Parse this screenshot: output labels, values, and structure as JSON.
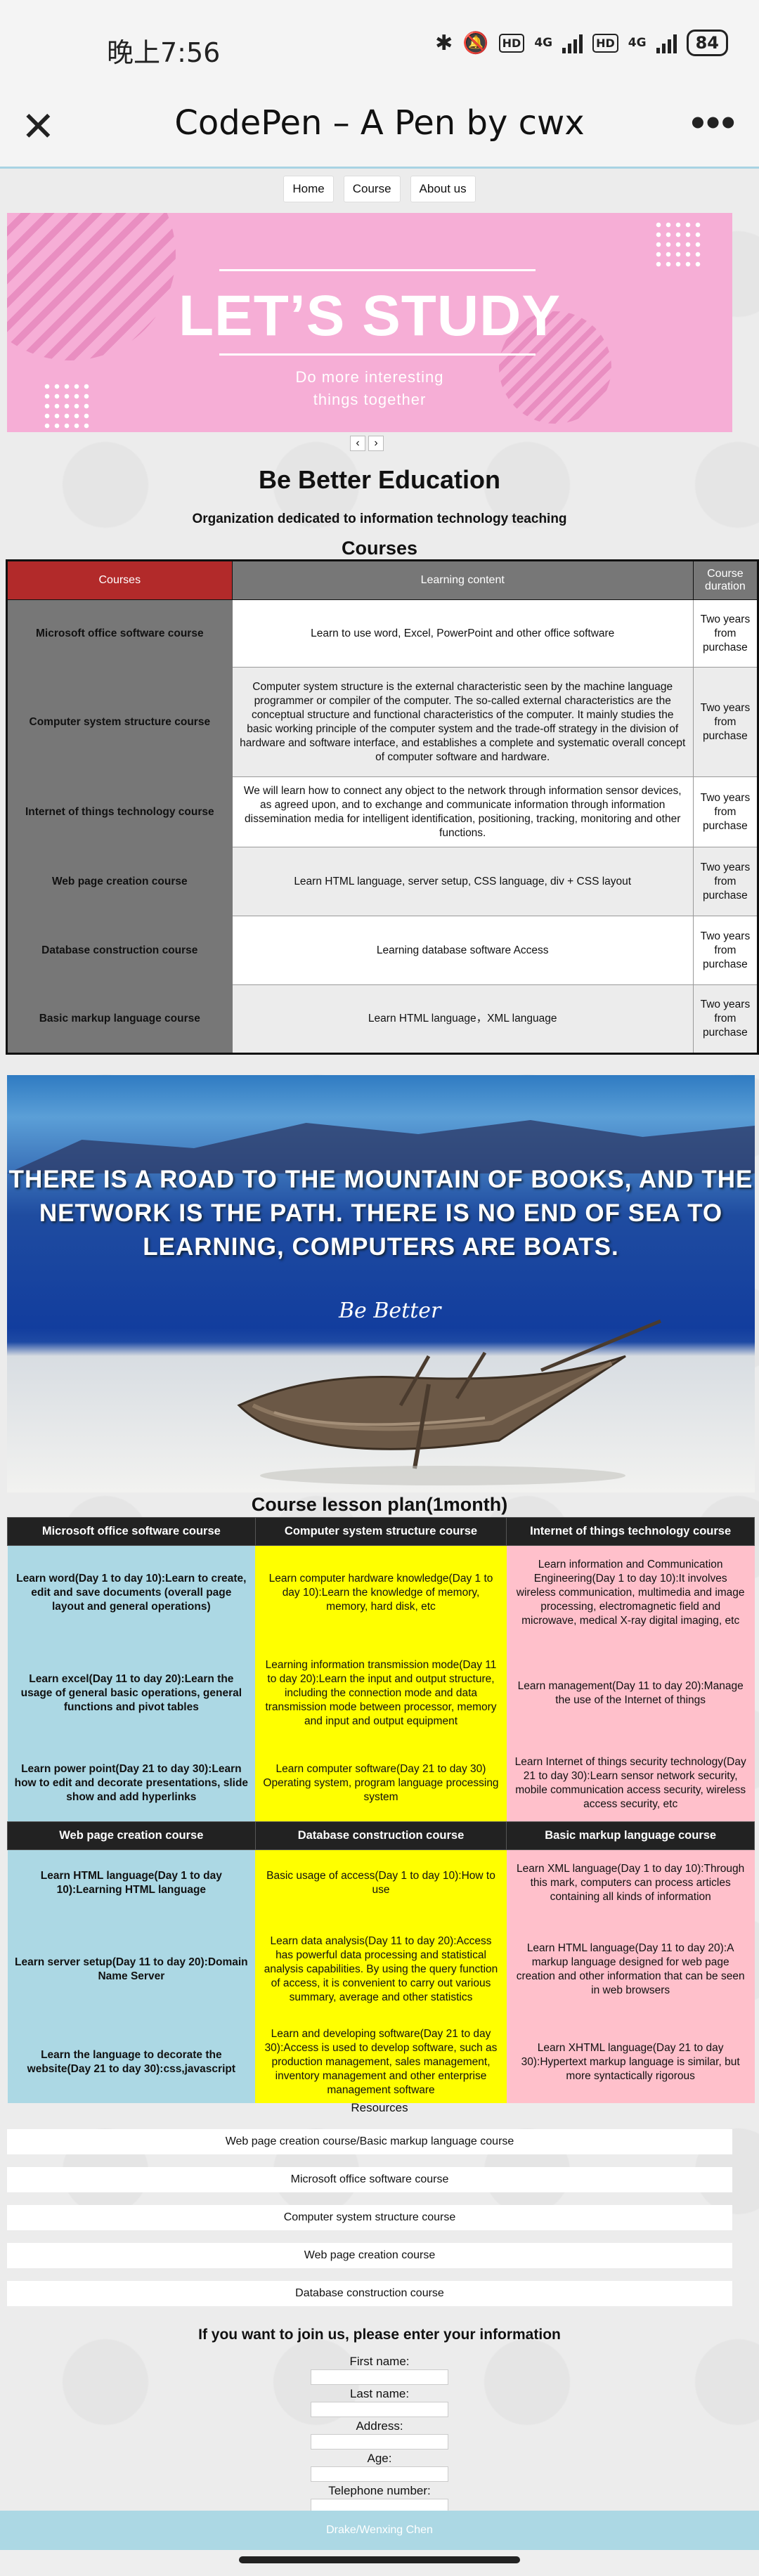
{
  "status_bar": {
    "time": "晚上7:56",
    "network_4g_a": "4G",
    "network_4g_b": "4G",
    "hd_a": "HD",
    "hd_b": "HD",
    "battery": "84"
  },
  "app_header": {
    "title": "CodePen – A Pen by cwx",
    "close_icon": "close-icon",
    "more_icon": "more-icon"
  },
  "nav": {
    "items": [
      "Home",
      "Course",
      "About us"
    ]
  },
  "banner": {
    "title": "LET’S STUDY",
    "subtitle_line1": "Do more interesting",
    "subtitle_line2": "things together",
    "colors": {
      "background": "#f6aed6"
    }
  },
  "carousel": {
    "prev": "‹",
    "next": "›"
  },
  "headings": {
    "main": "Be Better Education",
    "sub": "Organization dedicated to information technology teaching",
    "courses": "Courses",
    "plan": "Course lesson plan(1month)",
    "resources": "Resources",
    "form": "If you want to join us, please enter your information"
  },
  "course_table": {
    "headers": [
      "Courses",
      "Learning content",
      "Course duration"
    ],
    "rows": [
      {
        "name": "Microsoft office software course",
        "content": "Learn to use word, Excel, PowerPoint and other office software",
        "duration": "Two years from purchase"
      },
      {
        "name": "Computer system structure course",
        "content": "Computer system structure is the external characteristic seen by the machine language programmer or compiler of the computer. The so-called external characteristics are the conceptual structure and functional characteristics of the computer. It mainly studies the basic working principle of the computer system and the trade-off strategy in the division of hardware and software interface, and establishes a complete and systematic overall concept of computer software and hardware.",
        "duration": "Two years from purchase"
      },
      {
        "name": "Internet of things technology course",
        "content": "We will learn how to connect any object to the network through information sensor devices, as agreed upon, and to exchange and communicate information through information dissemination media for intelligent identification, positioning, tracking, monitoring and other functions.",
        "duration": "Two years from purchase"
      },
      {
        "name": "Web page creation course",
        "content": "Learn HTML language, server setup, CSS language, div + CSS layout",
        "duration": "Two years from purchase"
      },
      {
        "name": "Database construction course",
        "content": "Learning database software Access",
        "duration": "Two years from purchase"
      },
      {
        "name": "Basic markup language course",
        "content": "Learn HTML language，XML language",
        "duration": "Two years from purchase"
      }
    ]
  },
  "boat_image": {
    "text": "THERE IS A ROAD TO THE MOUNTAIN OF BOOKS, AND THE NETWORK IS THE PATH. THERE IS NO END OF SEA TO LEARNING,  COMPUTERS ARE BOATS.",
    "script": "Be Better"
  },
  "plan_table": {
    "groups": [
      {
        "headers": [
          "Microsoft office software course",
          "Computer system structure course",
          "Internet of things technology course"
        ],
        "rows": [
          [
            "Learn word(Day 1 to day 10):Learn to create, edit and save documents (overall page layout and general operations)",
            "Learn computer hardware knowledge(Day 1 to day 10):Learn the knowledge of memory, memory, hard disk, etc",
            "Learn information and Communication Engineering(Day 1 to day 10):It involves wireless communication, multimedia and image processing, electromagnetic field and microwave, medical X-ray digital imaging, etc"
          ],
          [
            "Learn excel(Day 11 to day 20):Learn the usage of general basic operations, general functions and pivot tables",
            "Learning information transmission mode(Day 11 to day 20):Learn the input and output structure, including the connection mode and data transmission mode between processor, memory and input and output equipment",
            "Learn management(Day 11 to day 20):Manage the use of the Internet of things"
          ],
          [
            "Learn power point(Day 21 to day 30):Learn how to edit and decorate presentations, slide show and add hyperlinks",
            "Learn computer software(Day 21 to day 30) Operating system, program language processing system",
            "Learn Internet of things security technology(Day 21 to day 30):Learn sensor network security, mobile communication access security, wireless access security, etc"
          ]
        ]
      },
      {
        "headers": [
          "Web page creation course",
          "Database construction course",
          "Basic markup language course"
        ],
        "rows": [
          [
            "Learn HTML language(Day 1 to day 10):Learning HTML language",
            "Basic usage of access(Day 1 to day 10):How to use",
            "Learn XML language(Day 1 to day 10):Through this mark, computers can process articles containing all kinds of information"
          ],
          [
            "Learn server setup(Day 11 to day 20):Domain Name Server",
            "Learn data analysis(Day 11 to day 20):Access has powerful data processing and statistical analysis capabilities. By using the query function of access, it is convenient to carry out various summary, average and other statistics",
            "Learn HTML language(Day 11 to day 20):A markup language designed for web page creation and other information that can be seen in web browsers"
          ],
          [
            "Learn the language to decorate the website(Day 21 to day 30):css,javascript",
            "Learn and developing software(Day 21 to day 30):Access is used to develop software, such as production management, sales management, inventory management and other enterprise management software",
            "Learn XHTML language(Day 21 to day 30):Hypertext markup language is similar, but more syntactically rigorous"
          ]
        ]
      }
    ]
  },
  "resources": {
    "items": [
      "Web page creation course/Basic markup language course",
      "Microsoft office software course",
      "Computer system structure course",
      "Web page creation course",
      "Database construction course"
    ]
  },
  "form": {
    "fields": [
      "First name:",
      "Last name:",
      "Address:",
      "Age:",
      "Telephone number:"
    ]
  },
  "footer": {
    "text": "Drake/Wenxing Chen"
  }
}
